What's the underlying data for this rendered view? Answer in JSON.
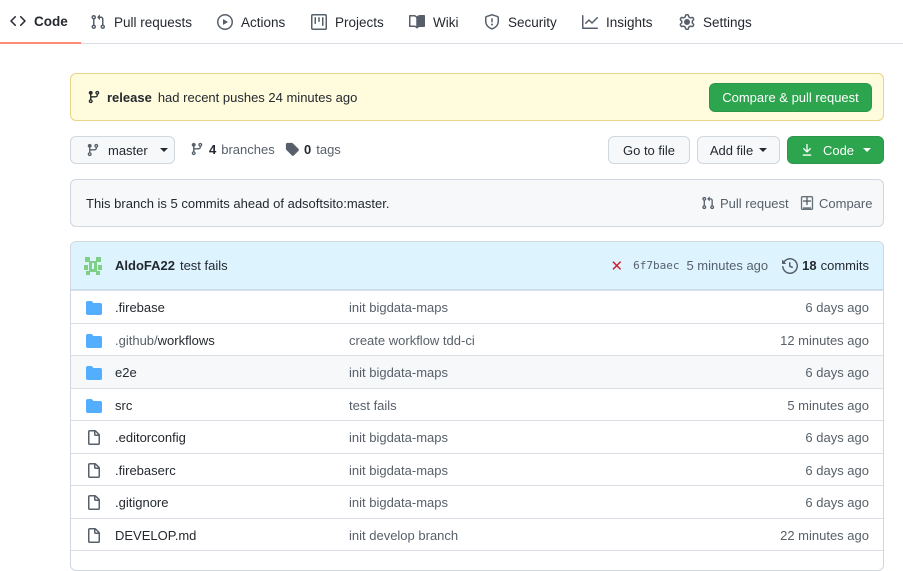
{
  "tabs": [
    {
      "label": "Code",
      "icon": "code-icon",
      "active": true
    },
    {
      "label": "Pull requests",
      "icon": "pull-request-icon"
    },
    {
      "label": "Actions",
      "icon": "play-icon"
    },
    {
      "label": "Projects",
      "icon": "project-icon"
    },
    {
      "label": "Wiki",
      "icon": "book-icon"
    },
    {
      "label": "Security",
      "icon": "shield-icon"
    },
    {
      "label": "Insights",
      "icon": "graph-icon"
    },
    {
      "label": "Settings",
      "icon": "gear-icon"
    }
  ],
  "flash": {
    "branch": "release",
    "text": "had recent pushes 24 minutes ago",
    "button": "Compare & pull request"
  },
  "branch_bar": {
    "branch": "master",
    "branches_count": "4",
    "branches_label": "branches",
    "tags_count": "0",
    "tags_label": "tags",
    "goto_file": "Go to file",
    "add_file": "Add file",
    "code": "Code"
  },
  "ahead": {
    "text": "This branch is 5 commits ahead of adsoftsito:master.",
    "pull_request": "Pull request",
    "compare": "Compare"
  },
  "latest_commit": {
    "author": "AldoFA22",
    "message": "test fails",
    "status": "✕",
    "sha": "6f7baec",
    "age": "5 minutes ago",
    "commits_count": "18",
    "commits_label": "commits"
  },
  "files": [
    {
      "type": "dir",
      "prefix": "",
      "name": ".firebase",
      "message": "init bigdata-maps",
      "age": "6 days ago"
    },
    {
      "type": "dir",
      "prefix": ".github/",
      "name": "workflows",
      "message": "create workflow tdd-ci",
      "age": "12 minutes ago"
    },
    {
      "type": "dir",
      "prefix": "",
      "name": "e2e",
      "message": "init bigdata-maps",
      "age": "6 days ago"
    },
    {
      "type": "dir",
      "prefix": "",
      "name": "src",
      "message": "test fails",
      "age": "5 minutes ago"
    },
    {
      "type": "file",
      "prefix": "",
      "name": ".editorconfig",
      "message": "init bigdata-maps",
      "age": "6 days ago"
    },
    {
      "type": "file",
      "prefix": "",
      "name": ".firebaserc",
      "message": "init bigdata-maps",
      "age": "6 days ago"
    },
    {
      "type": "file",
      "prefix": "",
      "name": ".gitignore",
      "message": "init bigdata-maps",
      "age": "6 days ago"
    },
    {
      "type": "file",
      "prefix": "",
      "name": "DEVELOP.md",
      "message": "init develop branch",
      "age": "22 minutes ago"
    }
  ],
  "colors": {
    "accent_green": "#2da44e",
    "active_tab_underline": "#fd8c73",
    "folder_blue": "#54aeff",
    "fail_red": "#cf222e",
    "flash_bg": "#fffbdd",
    "commit_header_bg": "#ddf4ff"
  }
}
